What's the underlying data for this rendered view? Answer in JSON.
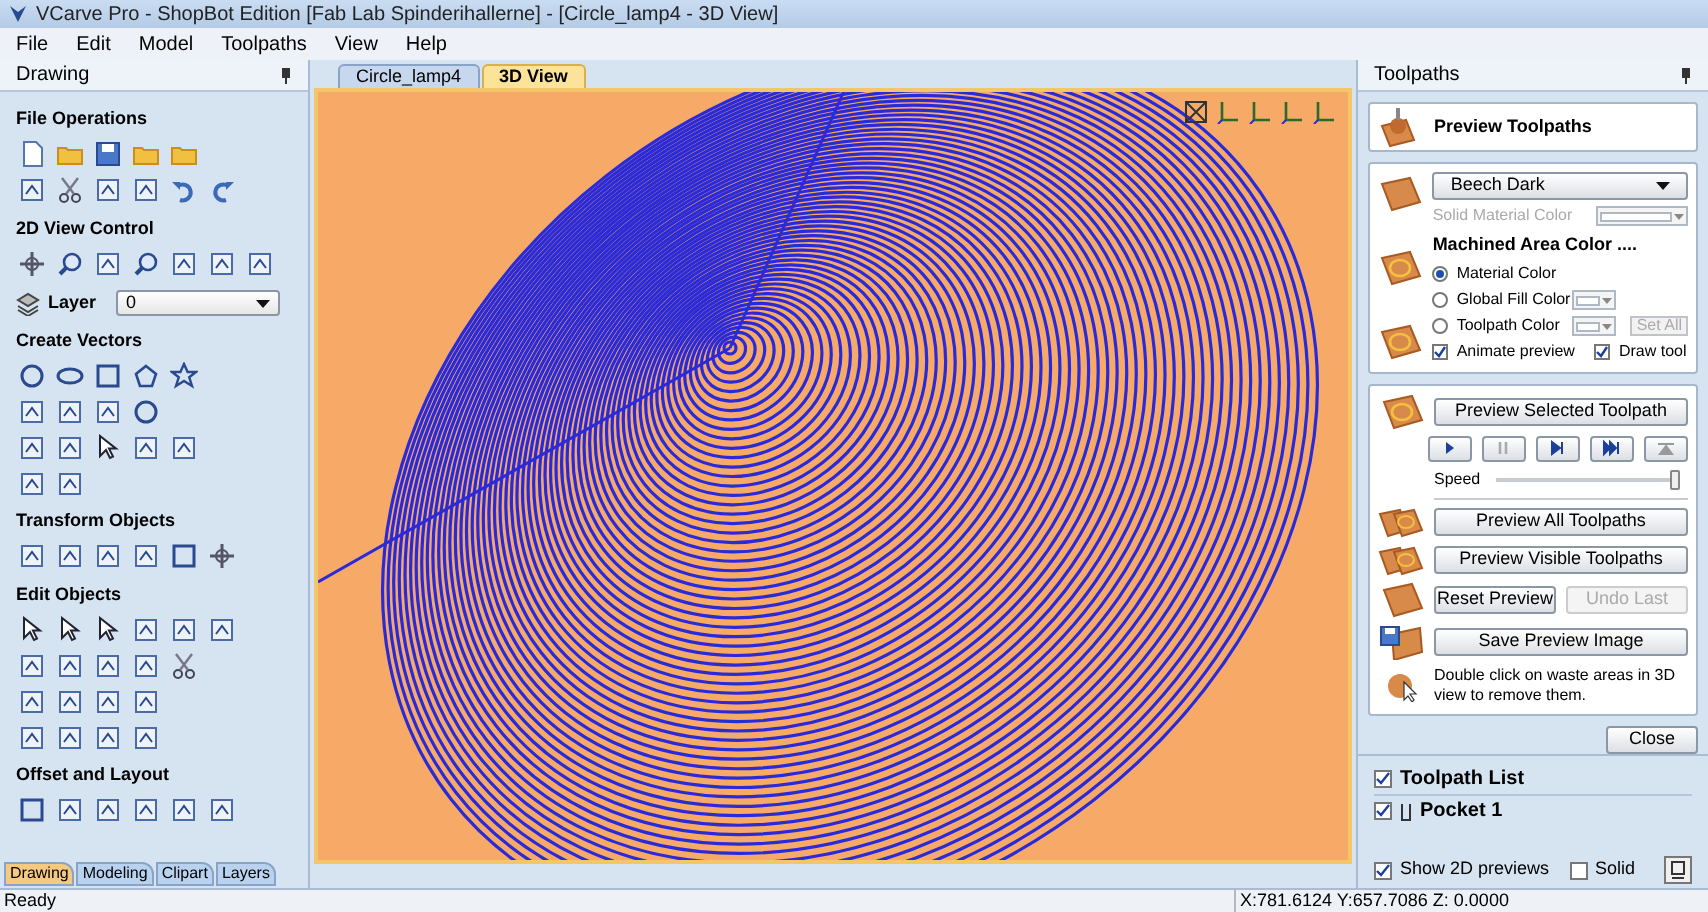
{
  "window": {
    "title": "VCarve Pro - ShopBot Edition [Fab Lab Spinderihallerne] - [Circle_lamp4 - 3D View]"
  },
  "menu": [
    "File",
    "Edit",
    "Model",
    "Toolpaths",
    "View",
    "Help"
  ],
  "drawing_panel": {
    "title": "Drawing",
    "sections": [
      {
        "title": "File Operations"
      },
      {
        "title": "2D View Control"
      },
      {
        "title": "Create Vectors"
      },
      {
        "title": "Transform Objects"
      },
      {
        "title": "Edit Objects"
      },
      {
        "title": "Offset and Layout"
      }
    ],
    "layer": {
      "label": "Layer",
      "value": "0"
    },
    "tabs": [
      {
        "label": "Drawing",
        "selected": true
      },
      {
        "label": "Modeling",
        "selected": false
      },
      {
        "label": "Clipart",
        "selected": false
      },
      {
        "label": "Layers",
        "selected": false
      }
    ]
  },
  "document_tabs": [
    {
      "label": "Circle_lamp4",
      "selected": false
    },
    {
      "label": "3D View",
      "selected": true
    }
  ],
  "toolpaths_panel": {
    "title": "Toolpaths",
    "heading": "Preview Toolpaths",
    "material": {
      "value": "Beech Dark",
      "solid_color_label": "Solid Material Color",
      "solid_color_disabled": true
    },
    "machined_area": {
      "title": "Machined Area Color ....",
      "options": [
        {
          "label": "Material Color",
          "selected": true
        },
        {
          "label": "Global Fill Color",
          "selected": false
        },
        {
          "label": "Toolpath Color",
          "selected": false
        }
      ],
      "set_all": {
        "label": "Set All",
        "disabled": true
      }
    },
    "checkboxes": [
      {
        "label": "Animate preview",
        "checked": true
      },
      {
        "label": "Draw tool",
        "checked": true
      }
    ],
    "preview_selected": "Preview Selected Toolpath",
    "speed": {
      "label": "Speed",
      "level": 1.0
    },
    "buttons": [
      {
        "label": "Preview All Toolpaths"
      },
      {
        "label": "Preview Visible Toolpaths"
      }
    ],
    "reset": {
      "label": "Reset Preview",
      "disabled": false
    },
    "undo": {
      "label": "Undo Last",
      "disabled": true
    },
    "save": "Save Preview Image",
    "note": "Double click on waste areas in 3D view to remove them.",
    "close": "Close",
    "list": [
      {
        "label": "Toolpath List",
        "checked": true,
        "kind": "header"
      },
      {
        "label": "Pocket 1",
        "checked": true,
        "kind": "item"
      }
    ],
    "show_2d": {
      "label": "Show 2D previews",
      "checked": true
    },
    "solid": {
      "label": "Solid",
      "checked": false
    }
  },
  "status_bar": {
    "text": "Ready",
    "coordinates": "X:781.6124 Y:657.7086 Z: 0.0000"
  }
}
